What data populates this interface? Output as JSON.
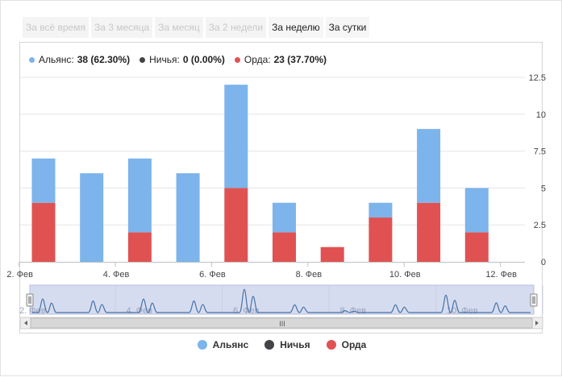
{
  "tabs": [
    {
      "label": "За всё время",
      "active": false
    },
    {
      "label": "За 3 месяца",
      "active": false
    },
    {
      "label": "За месяц",
      "active": false
    },
    {
      "label": "За 2 недели",
      "active": false
    },
    {
      "label": "За неделю",
      "active": true
    },
    {
      "label": "За сутки",
      "active": true
    }
  ],
  "summary": [
    {
      "name": "Альянс",
      "value": "38 (62.30%)",
      "color": "#7cb4eb"
    },
    {
      "name": "Ничья",
      "value": "0 (0.00%)",
      "color": "#434348"
    },
    {
      "name": "Орда",
      "value": "23 (37.70%)",
      "color": "#e05252"
    }
  ],
  "chart_data": {
    "type": "bar",
    "stacked": true,
    "x": [
      "2014-02-02",
      "2014-02-03",
      "2014-02-04",
      "2014-02-05",
      "2014-02-06",
      "2014-02-07",
      "2014-02-08",
      "2014-02-09",
      "2014-02-10",
      "2014-02-11"
    ],
    "series": [
      {
        "name": "Альянс",
        "color": "#7cb4eb",
        "values": [
          3,
          6,
          5,
          6,
          7,
          2,
          0,
          1,
          5,
          3
        ]
      },
      {
        "name": "Ничья",
        "color": "#434348",
        "values": [
          0,
          0,
          0,
          0,
          0,
          0,
          0,
          0,
          0,
          0
        ]
      },
      {
        "name": "Орда",
        "color": "#e05252",
        "values": [
          4,
          0,
          2,
          0,
          5,
          2,
          1,
          3,
          4,
          2
        ]
      }
    ],
    "ylim": [
      0,
      12.5
    ],
    "yticks": [
      "0",
      "2.5",
      "5",
      "7.5",
      "10",
      "12.5"
    ],
    "xticks": [
      {
        "label": "2. Фев",
        "day": 0
      },
      {
        "label": "4. Фев",
        "day": 2
      },
      {
        "label": "6. Фев",
        "day": 4
      },
      {
        "label": "8. Фев",
        "day": 6
      },
      {
        "label": "10. Фев",
        "day": 8
      },
      {
        "label": "12. Фев",
        "day": 10
      }
    ],
    "grid": true,
    "legend": "bottom-center",
    "navigator": {
      "labels": [
        "2. Фев",
        "4. Фев",
        "6. Фев",
        "8. Фев",
        "10. Фев"
      ],
      "scroll_label": "III"
    }
  }
}
